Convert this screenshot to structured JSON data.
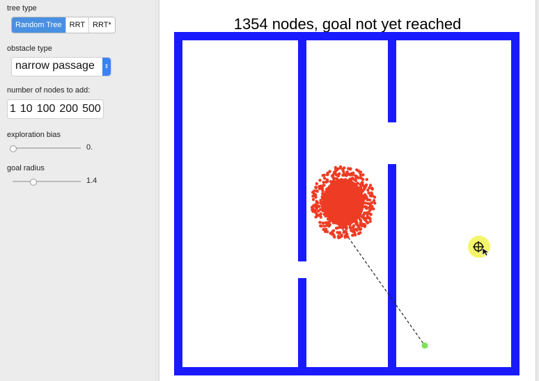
{
  "controls": {
    "tree_type": {
      "label": "tree type",
      "options": [
        "Random Tree",
        "RRT",
        "RRT*"
      ],
      "selected": "Random Tree"
    },
    "obstacle_type": {
      "label": "obstacle type",
      "value": "narrow passage"
    },
    "nodes_to_add": {
      "label": "number of nodes to add:",
      "options": [
        "1",
        "10",
        "100",
        "200",
        "500"
      ]
    },
    "exploration_bias": {
      "label": "exploration bias",
      "value": "0.",
      "level": 0.0
    },
    "goal_radius": {
      "label": "goal radius",
      "value": "1.4",
      "level": 0.3
    }
  },
  "canvas": {
    "status": "1354 nodes, goal not yet reached",
    "colors": {
      "walls": "#1a1aff",
      "nodes": "#ee3b24",
      "start": "#7be35a",
      "goal": "#f5f56a"
    },
    "icons": [
      "crosshair-icon"
    ]
  }
}
